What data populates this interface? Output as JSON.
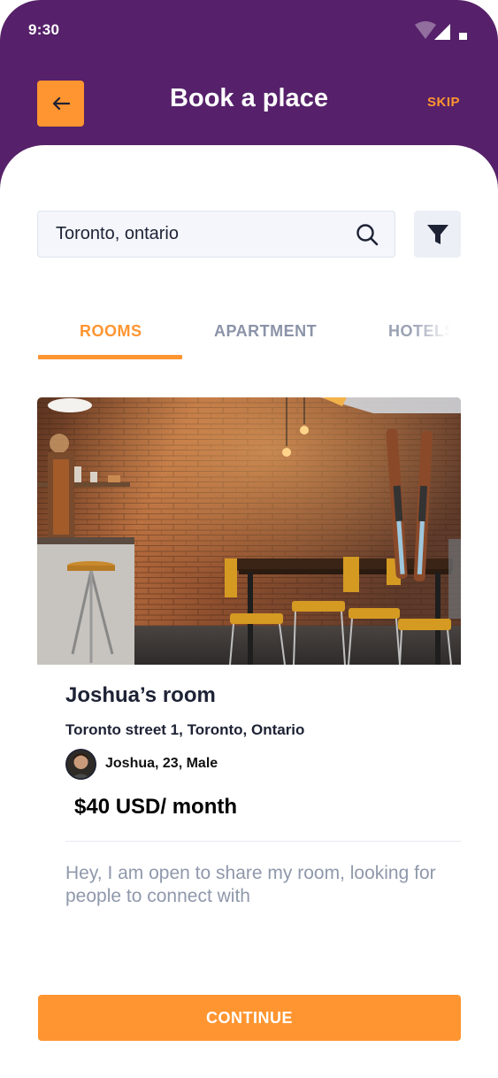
{
  "status_bar": {
    "time": "9:30",
    "icons": [
      "wifi-icon",
      "signal-icon",
      "battery-icon"
    ]
  },
  "header": {
    "back_icon": "arrow-left-icon",
    "title": "Book a place",
    "skip_label": "SKIP"
  },
  "search": {
    "value": "Toronto, ontario",
    "search_icon": "search-icon",
    "filter_icon": "filter-icon"
  },
  "tabs": [
    {
      "label": "ROOMS",
      "active": true
    },
    {
      "label": "APARTMENT",
      "active": false
    },
    {
      "label": "HOTELS",
      "active": false
    }
  ],
  "listing": {
    "title": "Joshua’s room",
    "address": "Toronto street 1, Toronto, Ontario",
    "host": "Joshua, 23, Male",
    "price": "$40 USD/ month",
    "description": "Hey, I am open to share my room, looking for people to connect with"
  },
  "continue_label": "CONTINUE",
  "colors": {
    "header": "#56216a",
    "accent": "#ff9530",
    "text_dark": "#1d2235",
    "text_muted": "#8f98ab"
  }
}
